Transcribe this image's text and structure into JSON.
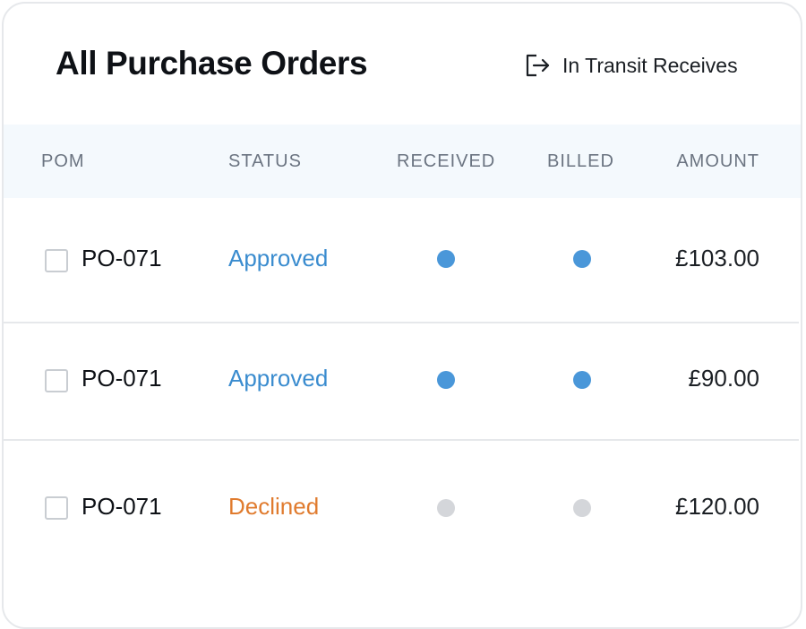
{
  "page": {
    "title": "All Purchase Orders",
    "transit_link_label": "In Transit Receives",
    "transit_link_icon": "sign-out-icon"
  },
  "table": {
    "headers": {
      "pom": "POM",
      "status": "STATUS",
      "received": "RECEIVED",
      "billed": "BILLED",
      "amount": "AMOUNT"
    },
    "rows": [
      {
        "po_number": "PO-071",
        "status": "Approved",
        "status_color": "#3a8ccf",
        "received_color": "#4a97d9",
        "billed_color": "#4a97d9",
        "amount": "£103.00",
        "checked": false
      },
      {
        "po_number": "PO-071",
        "status": "Approved",
        "status_color": "#3a8ccf",
        "received_color": "#4a97d9",
        "billed_color": "#4a97d9",
        "amount": "£90.00",
        "checked": false
      },
      {
        "po_number": "PO-071",
        "status": "Declined",
        "status_color": "#e07b2e",
        "received_color": "#d4d6da",
        "billed_color": "#d4d6da",
        "amount": "£120.00",
        "checked": false
      }
    ]
  },
  "colors": {
    "header_background": "#f4f9fd",
    "approved": "#3a8ccf",
    "declined": "#e07b2e",
    "dot_active": "#4a97d9",
    "dot_inactive": "#d4d6da"
  }
}
